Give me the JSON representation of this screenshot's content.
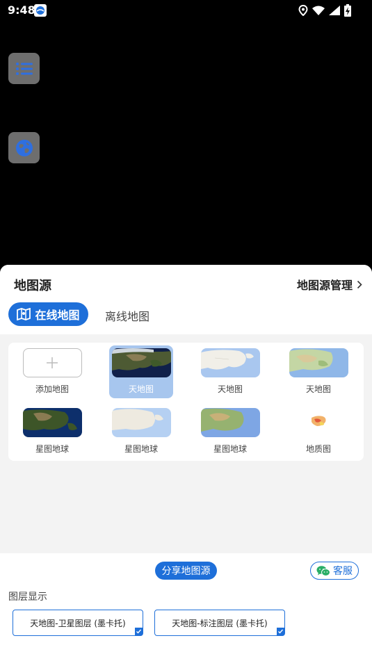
{
  "status": {
    "time": "9:48"
  },
  "sheet": {
    "title": "地图源",
    "manage_label": "地图源管理",
    "tabs": {
      "online": "在线地图",
      "offline": "离线地图"
    }
  },
  "map_items": [
    {
      "label": "添加地图"
    },
    {
      "label": "天地图"
    },
    {
      "label": "天地图"
    },
    {
      "label": "天地图"
    },
    {
      "label": "星图地球"
    },
    {
      "label": "星图地球"
    },
    {
      "label": "星图地球"
    },
    {
      "label": "地质图"
    }
  ],
  "bottom": {
    "share_label": "分享地图源",
    "service_label": "客服",
    "layers_title": "图层显示",
    "layers": [
      {
        "label": "天地图-卫星图层 (墨卡托)"
      },
      {
        "label": "天地图-标注图层 (墨卡托)"
      }
    ]
  },
  "colors": {
    "accent": "#1e6fd9",
    "selected_bg": "#a7c6ee",
    "wechat_green": "#2aae67"
  }
}
